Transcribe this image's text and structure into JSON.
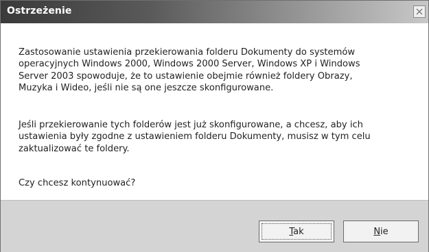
{
  "window": {
    "title": "Ostrzeżenie",
    "close_icon": "close-icon"
  },
  "message": {
    "paragraph1": "Zastosowanie ustawienia przekierowania folderu Dokumenty do systemów\noperacyjnych Windows 2000, Windows 2000 Server, Windows XP i Windows\nServer 2003 spowoduje, że to ustawienie obejmie również foldery Obrazy,\nMuzyka i Wideo, jeśli nie są one jeszcze skonfigurowane.",
    "paragraph2": "Jeśli przekierowanie tych folderów jest już skonfigurowane, a chcesz, aby ich\nustawienia były zgodne z ustawieniem folderu Dokumenty, musisz w tym celu\nzaktualizować te foldery.",
    "paragraph3": "Czy chcesz kontynuować?"
  },
  "buttons": {
    "yes_mnemonic": "T",
    "yes_rest": "ak",
    "no_mnemonic": "N",
    "no_rest": "ie"
  }
}
